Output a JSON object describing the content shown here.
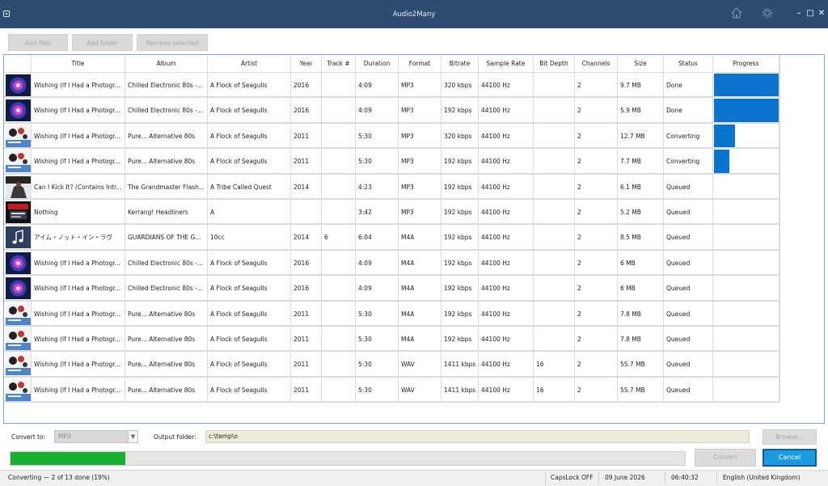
{
  "window": {
    "title": "Audio2Many"
  },
  "toolbar": {
    "add_files": "Add files",
    "add_folder": "Add folder",
    "remove_selected": "Remove selected"
  },
  "table": {
    "columns": [
      "",
      "Title",
      "Album",
      "Artist",
      "Year",
      "Track #",
      "Duration",
      "Format",
      "Bitrate",
      "Sample Rate",
      "Bit Depth",
      "Channels",
      "Size",
      "Status",
      "Progress"
    ],
    "rows": [
      {
        "thumb": "ministry-art",
        "title": "Wishing (If I Had a Photogr...",
        "album": "Chilled Electronic 80s -...",
        "artist": "A Flock of Seagulls",
        "year": "2016",
        "track": "",
        "duration": "4:09",
        "format": "MP3",
        "bitrate": "320 kbps",
        "sample_rate": "44100 Hz",
        "bit_depth": "",
        "channels": "2",
        "size": "9.7 MB",
        "status": "Done",
        "progress": 1.0
      },
      {
        "thumb": "ministry-art",
        "title": "Wishing (If I Had a Photogr...",
        "album": "Chilled Electronic 80s -...",
        "artist": "A Flock of Seagulls",
        "year": "2016",
        "track": "",
        "duration": "4:09",
        "format": "MP3",
        "bitrate": "192 kbps",
        "sample_rate": "44100 Hz",
        "bit_depth": "",
        "channels": "2",
        "size": "5.9 MB",
        "status": "Done",
        "progress": 1.0
      },
      {
        "thumb": "pure80s-art",
        "title": "Wishing (If I Had a Photogr...",
        "album": "Pure... Alternative 80s",
        "artist": "A Flock of Seagulls",
        "year": "2011",
        "track": "",
        "duration": "5:30",
        "format": "MP3",
        "bitrate": "320 kbps",
        "sample_rate": "44100 Hz",
        "bit_depth": "",
        "channels": "2",
        "size": "12.7 MB",
        "status": "Converting",
        "progress": 0.32
      },
      {
        "thumb": "pure80s-art",
        "title": "Wishing (If I Had a Photogr...",
        "album": "Pure... Alternative 80s",
        "artist": "A Flock of Seagulls",
        "year": "2011",
        "track": "",
        "duration": "5:30",
        "format": "MP3",
        "bitrate": "192 kbps",
        "sample_rate": "44100 Hz",
        "bit_depth": "",
        "channels": "2",
        "size": "7.7 MB",
        "status": "Converting",
        "progress": 0.24
      },
      {
        "thumb": "grandmaster-art",
        "title": "Can I Kick It? (Contains Intr...",
        "album": "The Grandmaster Flash...",
        "artist": "A Tribe Called Quest",
        "year": "2014",
        "track": "",
        "duration": "4:23",
        "format": "MP3",
        "bitrate": "192 kbps",
        "sample_rate": "44100 Hz",
        "bit_depth": "",
        "channels": "2",
        "size": "6.1 MB",
        "status": "Queued",
        "progress": 0
      },
      {
        "thumb": "kerrang-art",
        "title": "Nothing",
        "album": "Kerrang! Headliners",
        "artist": "A",
        "year": "",
        "track": "",
        "duration": "3:42",
        "format": "MP3",
        "bitrate": "192 kbps",
        "sample_rate": "44100 Hz",
        "bit_depth": "",
        "channels": "2",
        "size": "5.2 MB",
        "status": "Queued",
        "progress": 0
      },
      {
        "thumb": "music-note-icon",
        "title": "アイム・ノット・イン・ラヴ",
        "album": "GUARDIANS OF THE G...",
        "artist": "10cc",
        "year": "2014",
        "track": "6",
        "duration": "6:04",
        "format": "M4A",
        "bitrate": "192 kbps",
        "sample_rate": "44100 Hz",
        "bit_depth": "",
        "channels": "2",
        "size": "8.5 MB",
        "status": "Queued",
        "progress": 0
      },
      {
        "thumb": "ministry-art",
        "title": "Wishing (If I Had a Photogr...",
        "album": "Chilled Electronic 80s -...",
        "artist": "A Flock of Seagulls",
        "year": "2016",
        "track": "",
        "duration": "4:09",
        "format": "M4A",
        "bitrate": "192 kbps",
        "sample_rate": "44100 Hz",
        "bit_depth": "",
        "channels": "2",
        "size": "6 MB",
        "status": "Queued",
        "progress": 0
      },
      {
        "thumb": "ministry-art",
        "title": "Wishing (If I Had a Photogr...",
        "album": "Chilled Electronic 80s -...",
        "artist": "A Flock of Seagulls",
        "year": "2016",
        "track": "",
        "duration": "4:09",
        "format": "M4A",
        "bitrate": "192 kbps",
        "sample_rate": "44100 Hz",
        "bit_depth": "",
        "channels": "2",
        "size": "6 MB",
        "status": "Queued",
        "progress": 0
      },
      {
        "thumb": "pure80s-art",
        "title": "Wishing (If I Had a Photogr...",
        "album": "Pure... Alternative 80s",
        "artist": "A Flock of Seagulls",
        "year": "2011",
        "track": "",
        "duration": "5:30",
        "format": "M4A",
        "bitrate": "192 kbps",
        "sample_rate": "44100 Hz",
        "bit_depth": "",
        "channels": "2",
        "size": "7.8 MB",
        "status": "Queued",
        "progress": 0
      },
      {
        "thumb": "pure80s-art",
        "title": "Wishing (If I Had a Photogr...",
        "album": "Pure... Alternative 80s",
        "artist": "A Flock of Seagulls",
        "year": "2011",
        "track": "",
        "duration": "5:30",
        "format": "M4A",
        "bitrate": "192 kbps",
        "sample_rate": "44100 Hz",
        "bit_depth": "",
        "channels": "2",
        "size": "7.8 MB",
        "status": "Queued",
        "progress": 0
      },
      {
        "thumb": "pure80s-art",
        "title": "Wishing (If I Had a Photogr...",
        "album": "Pure... Alternative 80s",
        "artist": "A Flock of Seagulls",
        "year": "2011",
        "track": "",
        "duration": "5:30",
        "format": "WAV",
        "bitrate": "1411 kbps",
        "sample_rate": "44100 Hz",
        "bit_depth": "16",
        "channels": "2",
        "size": "55.7 MB",
        "status": "Queued",
        "progress": 0
      },
      {
        "thumb": "pure80s-art",
        "title": "Wishing (If I Had a Photogr...",
        "album": "Pure... Alternative 80s",
        "artist": "A Flock of Seagulls",
        "year": "2011",
        "track": "",
        "duration": "5:30",
        "format": "WAV",
        "bitrate": "1411 kbps",
        "sample_rate": "44100 Hz",
        "bit_depth": "16",
        "channels": "2",
        "size": "55.7 MB",
        "status": "Queued",
        "progress": 0
      }
    ]
  },
  "convert": {
    "convert_to_label": "Convert to:",
    "format_value": "MP3",
    "output_folder_label": "Output folder:",
    "output_folder_value": "c:\\temp\\o",
    "browse_label": "Browse...",
    "convert_label": "Convert",
    "cancel_label": "Cancel",
    "overall_progress": 0.17
  },
  "statusbar": {
    "status": "Converting — 2 of 13 done (19%)",
    "capslock": "CapsLock OFF",
    "date": "09 June 2026",
    "time": "06:40:32",
    "locale": "English (United Kingdom)"
  },
  "colors": {
    "titlebar": "#2f4b71",
    "accent": "#0a74d0",
    "progress_green": "#17b02f",
    "cancel_button": "#1d9be2"
  }
}
